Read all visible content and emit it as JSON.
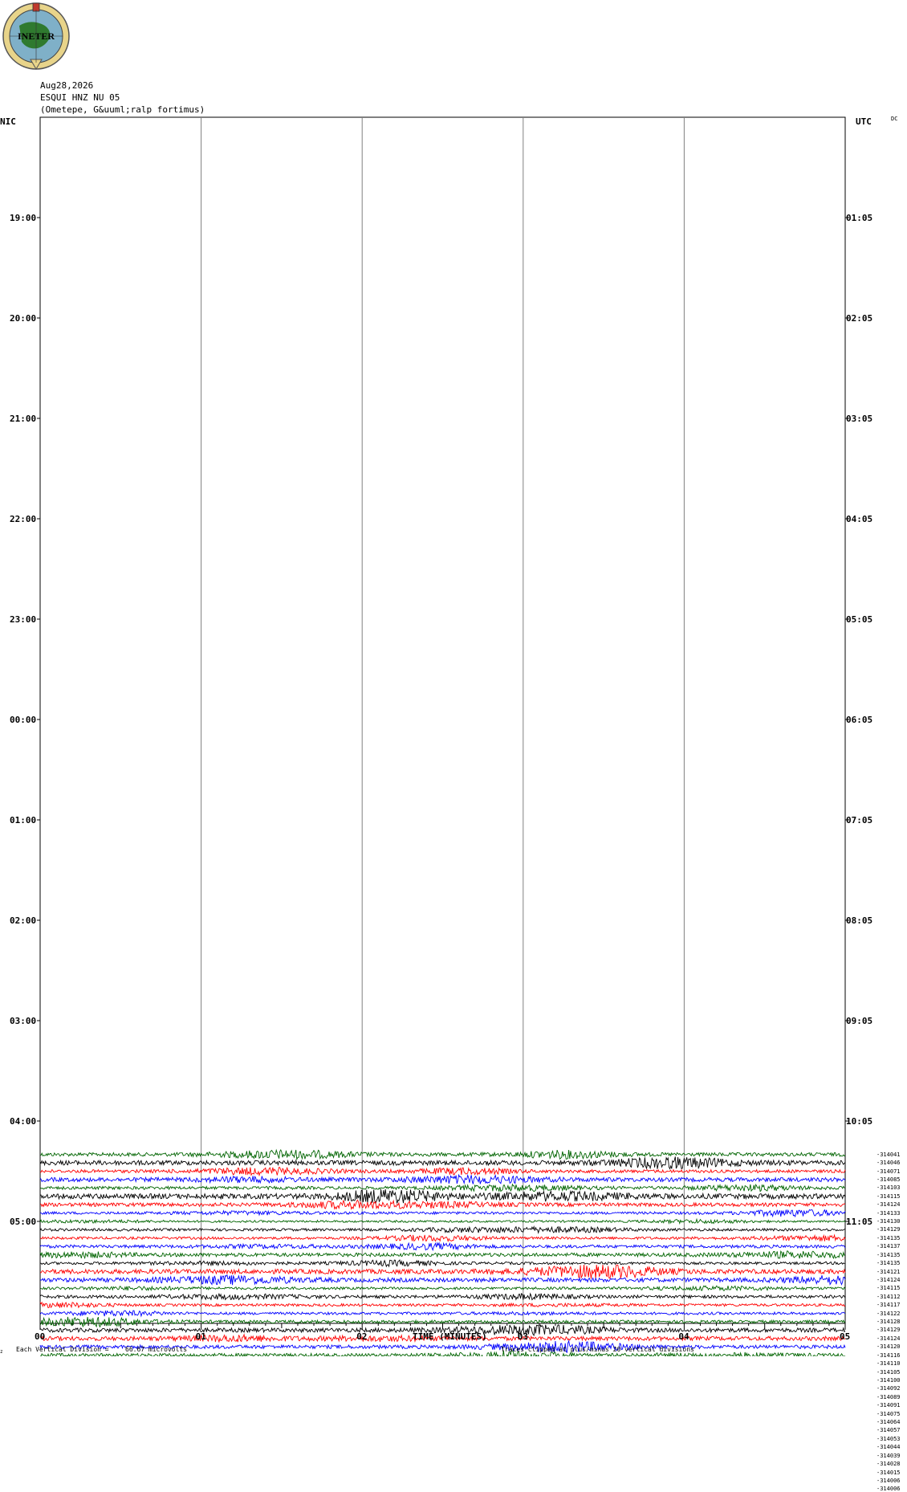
{
  "header": {
    "date": "Aug28,2026",
    "station": "ESQUI HNZ NU 05",
    "location": "(Ometepe, G&uuml;ralp fortimus)",
    "logo_text": "INETER"
  },
  "corner_labels": {
    "left": "NIC",
    "right": "UTC",
    "dc": "DC"
  },
  "footer": {
    "vertical_division_label": "Each Vertical Division =",
    "vertical_division_value": "66.67 microvolts",
    "clipping_note": "Traces clipped at plus/minus 20 vertical divisions",
    "corner_mark": "z"
  },
  "colors": {
    "black": "#000000",
    "red": "#ff0000",
    "blue": "#0000ff",
    "green": "#006400",
    "grid": "#808080"
  },
  "chart_data": {
    "type": "line",
    "title": "",
    "xlabel": "TIME (MINUTES)",
    "ylabel": "",
    "xlim": [
      0,
      5
    ],
    "x_ticks": [
      "00",
      "01",
      "02",
      "03",
      "04",
      "05"
    ],
    "vertical_gridlines_at": [
      1,
      2,
      3,
      4
    ],
    "left_time_labels": [
      "19:00",
      "20:00",
      "21:00",
      "22:00",
      "23:00",
      "00:00",
      "01:00",
      "02:00",
      "03:00",
      "04:00",
      "05:00"
    ],
    "right_time_labels": [
      "01:05",
      "02:05",
      "03:05",
      "04:05",
      "05:05",
      "06:05",
      "07:05",
      "08:05",
      "09:05",
      "10:05",
      "11:05"
    ],
    "trace_color_cycle": [
      "green",
      "black",
      "red",
      "blue"
    ],
    "first_trace_row": 124,
    "traces": [
      {
        "label": "-314041",
        "amp": 0.7
      },
      {
        "label": "-314046",
        "amp": 0.9
      },
      {
        "label": "-314071",
        "amp": 0.6
      },
      {
        "label": "-314085",
        "amp": 0.8
      },
      {
        "label": "-314103",
        "amp": 0.6
      },
      {
        "label": "-314115",
        "amp": 1.0
      },
      {
        "label": "-314124",
        "amp": 0.7
      },
      {
        "label": "-314133",
        "amp": 0.5
      },
      {
        "label": "-314130",
        "amp": 0.4
      },
      {
        "label": "-314129",
        "amp": 0.5
      },
      {
        "label": "-314135",
        "amp": 0.5
      },
      {
        "label": "-314137",
        "amp": 0.6
      },
      {
        "label": "-314135",
        "amp": 0.7
      },
      {
        "label": "-314135",
        "amp": 0.5
      },
      {
        "label": "-314121",
        "amp": 0.9
      },
      {
        "label": "-314124",
        "amp": 0.8
      },
      {
        "label": "-314115",
        "amp": 0.5
      },
      {
        "label": "-314112",
        "amp": 0.6
      },
      {
        "label": "-314117",
        "amp": 0.5
      },
      {
        "label": "-314122",
        "amp": 0.5
      },
      {
        "label": "-314128",
        "amp": 0.6
      },
      {
        "label": "-314129",
        "amp": 0.8
      },
      {
        "label": "-314124",
        "amp": 0.8
      },
      {
        "label": "-314120",
        "amp": 0.7
      },
      {
        "label": "-314116",
        "amp": 0.7
      },
      {
        "label": "-314110",
        "amp": 0.8
      },
      {
        "label": "-314105",
        "amp": 0.6
      },
      {
        "label": "-314100",
        "amp": 0.6
      },
      {
        "label": "-314092",
        "amp": 0.8
      },
      {
        "label": "-314089",
        "amp": 1.0
      },
      {
        "label": "-314091",
        "amp": 0.6
      },
      {
        "label": "-314075",
        "amp": 0.6
      },
      {
        "label": "-314064",
        "amp": 0.9
      },
      {
        "label": "-314057",
        "amp": 1.0
      },
      {
        "label": "-314053",
        "amp": 0.9
      },
      {
        "label": "-314044",
        "amp": 0.9
      },
      {
        "label": "-314039",
        "amp": 0.6
      },
      {
        "label": "-314028",
        "amp": 0.9
      },
      {
        "label": "-314015",
        "amp": 1.0
      },
      {
        "label": "-314006",
        "amp": 0.9
      },
      {
        "label": "-314006",
        "amp": 0.6
      }
    ]
  }
}
